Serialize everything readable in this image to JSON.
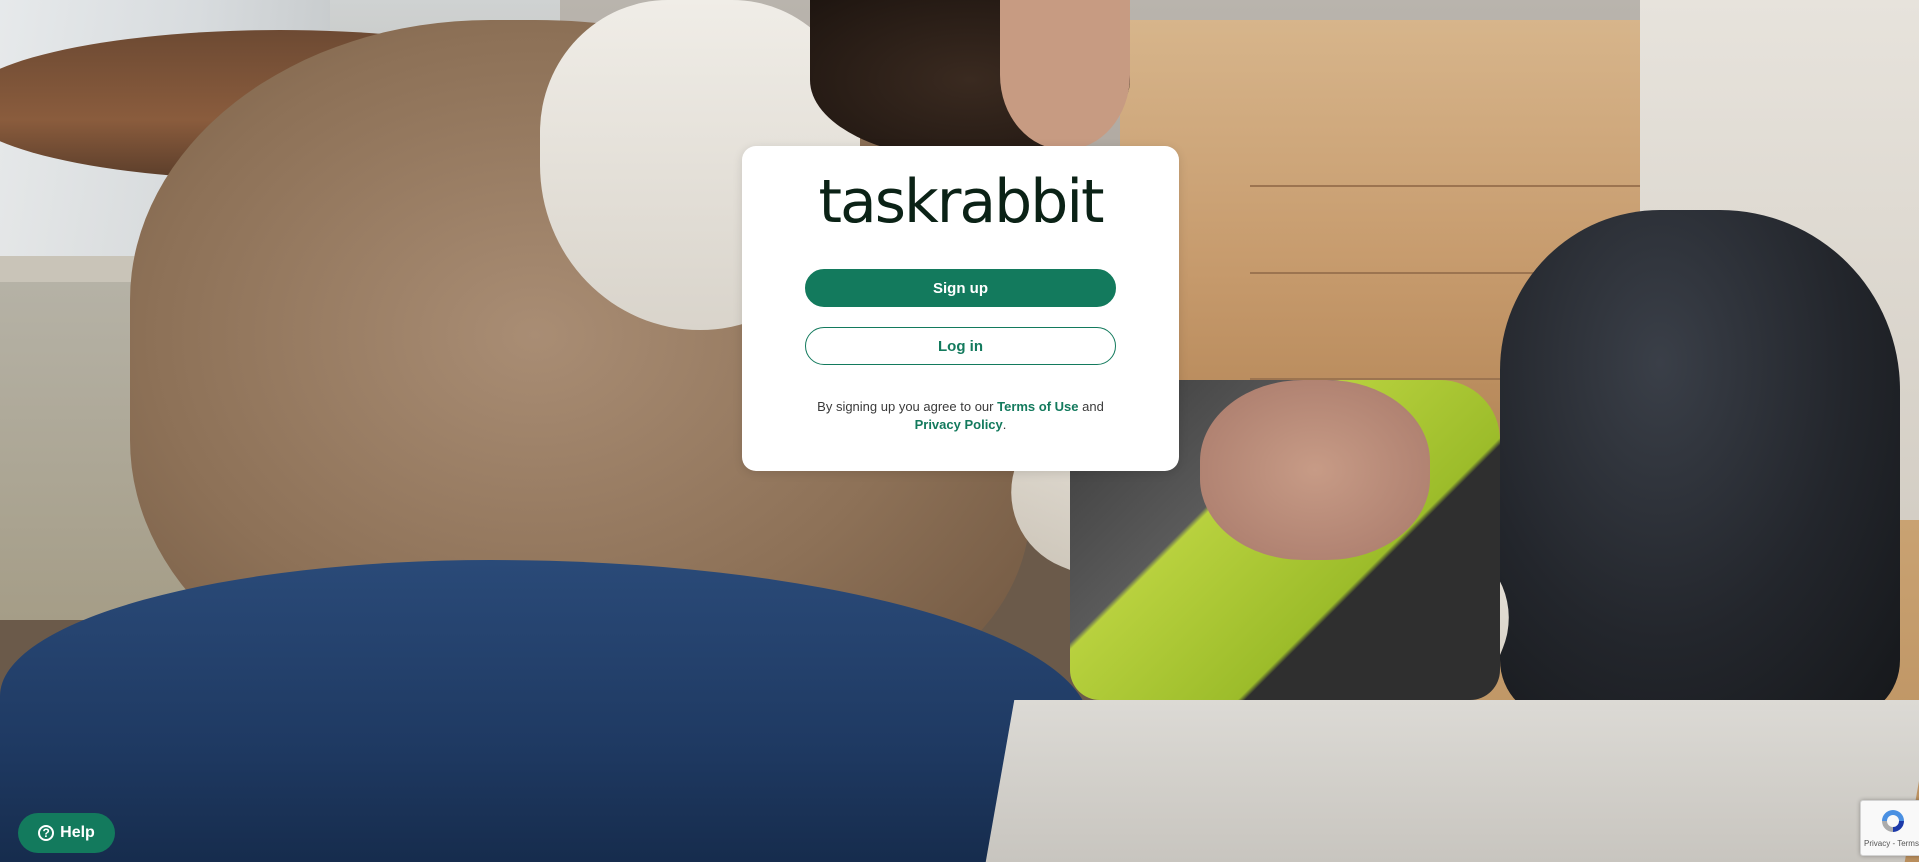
{
  "brand": {
    "logo_text": "taskrabbit",
    "accent_color": "#137a5d",
    "logo_color": "#0b2216"
  },
  "auth_card": {
    "signup_label": "Sign up",
    "login_label": "Log in",
    "legal_prefix": "By signing up you agree to our ",
    "terms_label": "Terms of Use",
    "legal_and": " and",
    "privacy_label": "Privacy Policy",
    "legal_suffix": "."
  },
  "help_widget": {
    "label": "Help",
    "icon": "question-circle-icon"
  },
  "recaptcha": {
    "text": "Privacy - Terms",
    "icon": "recaptcha-icon"
  },
  "background": {
    "description_icon": "background-photo"
  }
}
